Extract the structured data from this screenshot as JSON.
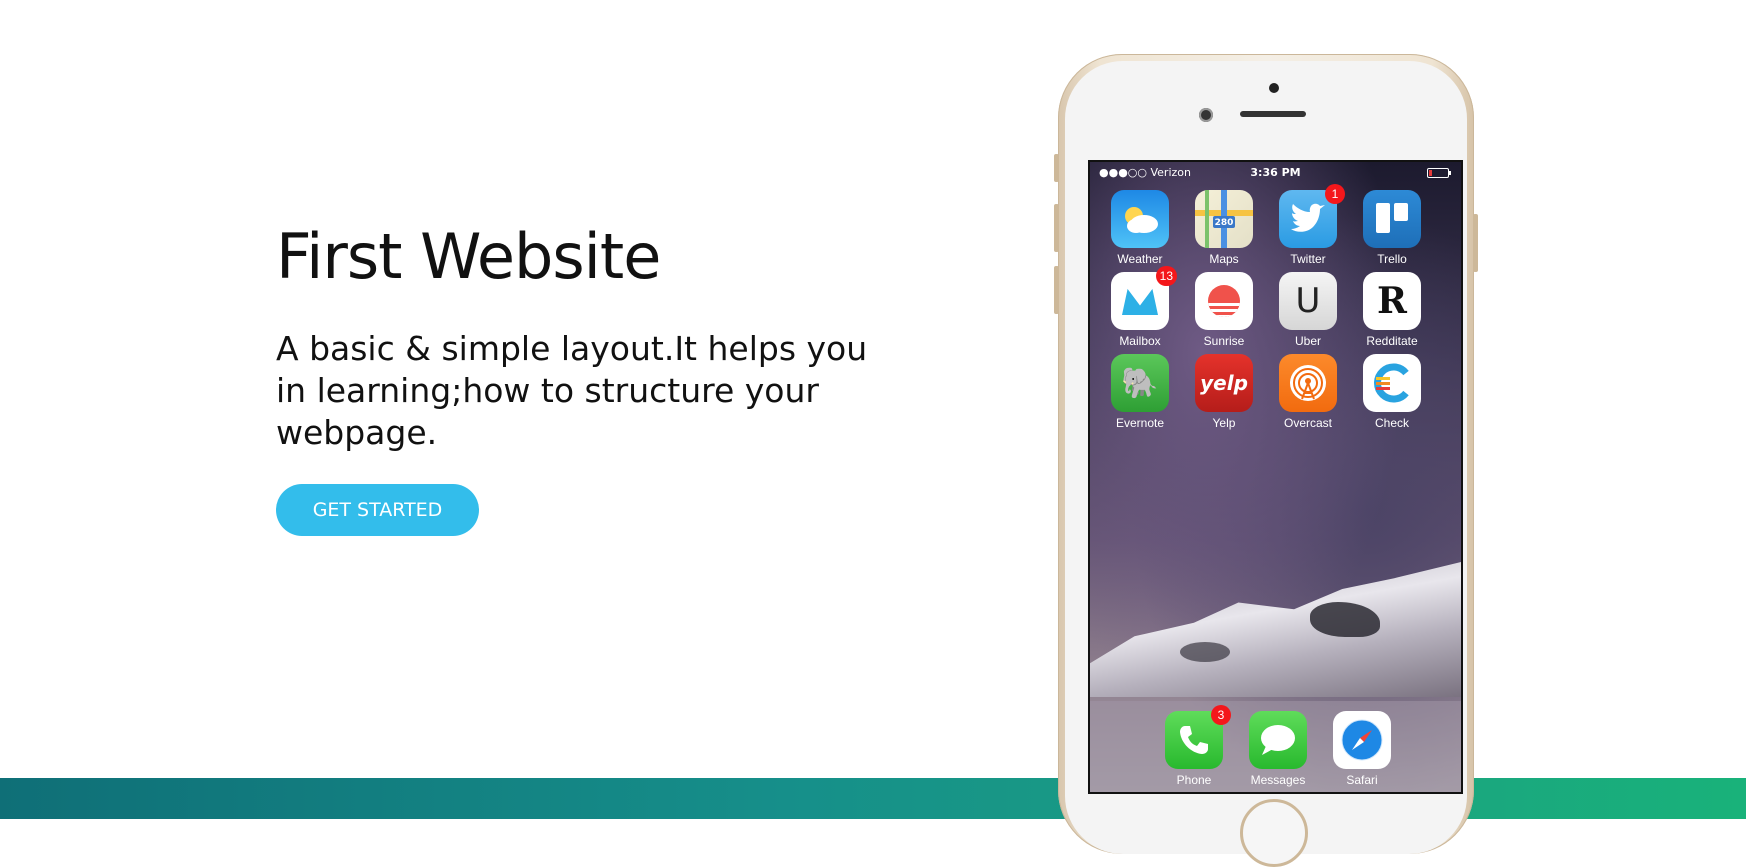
{
  "hero": {
    "title": "First Website",
    "subtitle": "A basic & simple layout.It helps you in learning;how to structure your webpage.",
    "cta_label": "GET STARTED"
  },
  "colors": {
    "accent": "#33bdeb",
    "band_start": "#0f6f77",
    "band_end": "#19b27a"
  },
  "phone": {
    "status": {
      "carrier": "●●●○○ Verizon",
      "time": "3:36 PM"
    },
    "apps": [
      {
        "label": "Weather",
        "icon": "weather-icon"
      },
      {
        "label": "Maps",
        "icon": "maps-icon"
      },
      {
        "label": "Twitter",
        "icon": "twitter-icon",
        "badge": "1"
      },
      {
        "label": "Trello",
        "icon": "trello-icon"
      },
      {
        "label": "Mailbox",
        "icon": "mailbox-icon",
        "badge": "13"
      },
      {
        "label": "Sunrise",
        "icon": "sunrise-icon"
      },
      {
        "label": "Uber",
        "icon": "uber-icon"
      },
      {
        "label": "Redditate",
        "icon": "redditate-icon"
      },
      {
        "label": "Evernote",
        "icon": "evernote-icon"
      },
      {
        "label": "Yelp",
        "icon": "yelp-icon"
      },
      {
        "label": "Overcast",
        "icon": "overcast-icon"
      },
      {
        "label": "Check",
        "icon": "check-icon"
      }
    ],
    "dock": [
      {
        "label": "Phone",
        "icon": "phone-icon",
        "badge": "3"
      },
      {
        "label": "Messages",
        "icon": "messages-icon"
      },
      {
        "label": "Safari",
        "icon": "safari-icon"
      }
    ],
    "app_glyphs": {
      "maps": "280",
      "uber": "U",
      "redditate": "R",
      "yelp": "yelp",
      "evernote": "🐘"
    }
  }
}
